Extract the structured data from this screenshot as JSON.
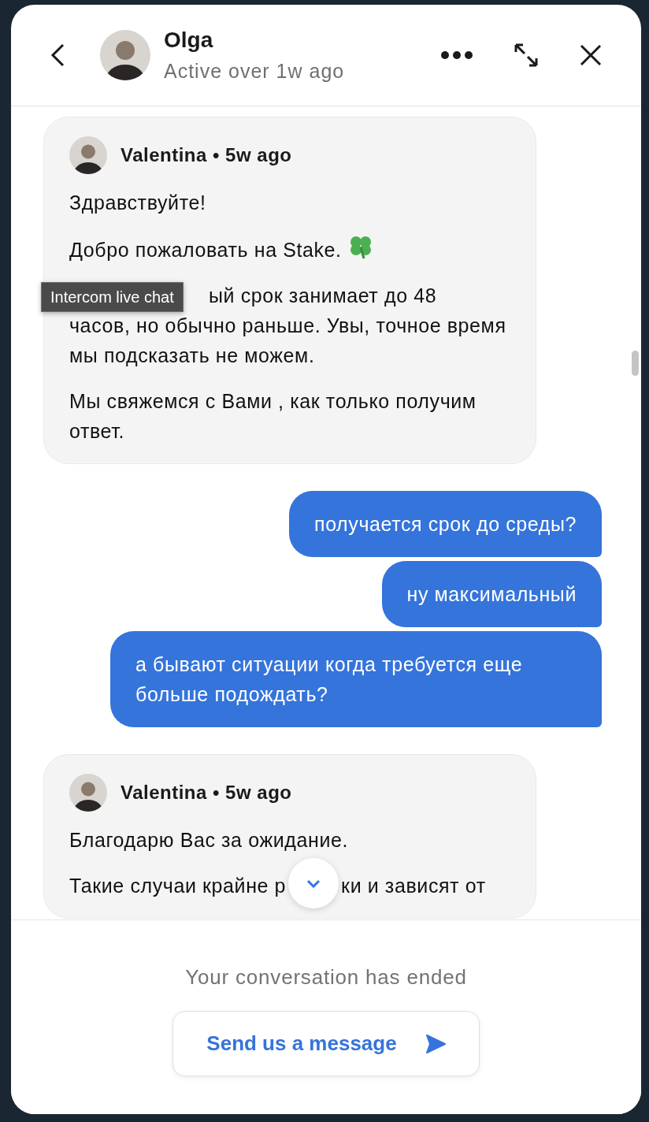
{
  "header": {
    "name": "Olga",
    "status": "Active over 1w ago"
  },
  "messages": [
    {
      "kind": "agent",
      "meta": "Valentina • 5w ago",
      "paragraphs": [
        {
          "kind": "plain",
          "text": "Здравствуйте!"
        },
        {
          "kind": "clover",
          "text": "Добро пожаловать на Stake."
        },
        {
          "kind": "under-tooltip",
          "parts": [
            "ый срок занимает до 48",
            "часов, но обычно раньше. Увы, точное время мы подсказать не можем."
          ]
        },
        {
          "kind": "plain",
          "text": "Мы свяжемся с Вами , как только получим ответ."
        }
      ]
    },
    {
      "kind": "user",
      "text": "получается срок до среды?"
    },
    {
      "kind": "user",
      "text": "ну максимальный"
    },
    {
      "kind": "user",
      "text": "а бывают ситуации когда требуется еще больше подождать?"
    },
    {
      "kind": "agent",
      "meta": "Valentina • 5w ago",
      "paragraphs": [
        {
          "kind": "plain",
          "text": "Благодарю Вас за ожидание."
        },
        {
          "kind": "split",
          "parts": [
            "Такие случаи крайне р",
            "ки и зависят от"
          ]
        }
      ]
    }
  ],
  "tooltip": {
    "text": "Intercom live chat"
  },
  "footer": {
    "notice": "Your conversation has ended",
    "button": "Send us a message"
  }
}
